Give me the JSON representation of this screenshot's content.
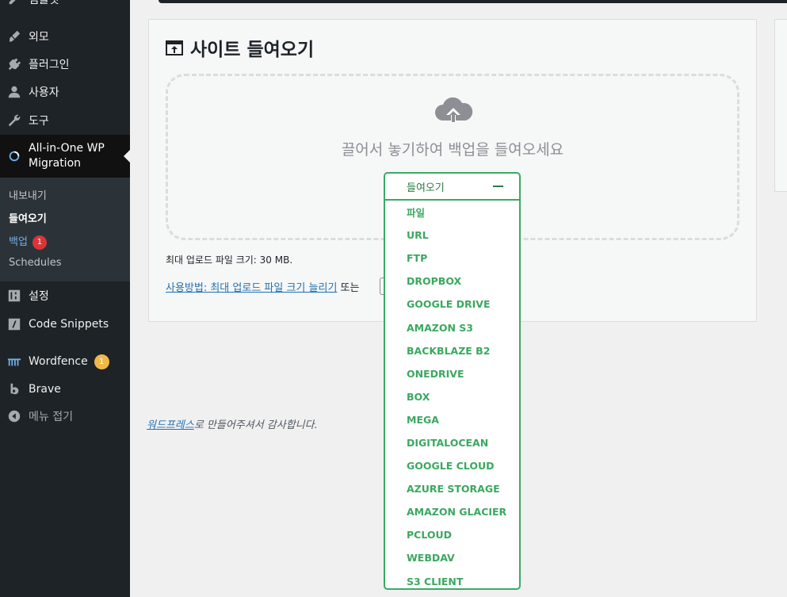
{
  "sidebar": {
    "items": [
      {
        "label": "템플릿",
        "icon": "pencil-icon"
      },
      {
        "label": "외모",
        "icon": "paintbrush-icon"
      },
      {
        "label": "플러그인",
        "icon": "plug-icon"
      },
      {
        "label": "사용자",
        "icon": "user-icon"
      },
      {
        "label": "도구",
        "icon": "wrench-icon"
      },
      {
        "label": "All-in-One WP Migration",
        "line1": "All-in-One WP",
        "line2": "Migration",
        "icon": "migration-icon"
      },
      {
        "label": "설정",
        "icon": "settings-icon"
      },
      {
        "label": "Code Snippets",
        "icon": "code-icon"
      },
      {
        "label": "Wordfence",
        "icon": "wordfence-icon",
        "badge": "1"
      },
      {
        "label": "Brave",
        "icon": "brave-icon"
      },
      {
        "label": "메뉴 접기",
        "icon": "collapse-icon"
      }
    ],
    "submenu": [
      {
        "label": "내보내기"
      },
      {
        "label": "들여오기"
      },
      {
        "label": "백업",
        "badge": "1"
      },
      {
        "label": "Schedules"
      }
    ]
  },
  "panel": {
    "title": "사이트 들여오기",
    "drop_text": "끌어서 놓기하여 백업을 들여오세요",
    "max_size": "최대 업로드 파일 크기: 30 MB.",
    "howto_link": "사용방법: 최대 업로드 파일 크기 늘리기",
    "howto_or": " 또는 "
  },
  "dropdown": {
    "label": "들여오기",
    "items": [
      "파일",
      "URL",
      "FTP",
      "DROPBOX",
      "GOOGLE DRIVE",
      "AMAZON S3",
      "BACKBLAZE B2",
      "ONEDRIVE",
      "BOX",
      "MEGA",
      "DIGITALOCEAN",
      "GOOGLE CLOUD",
      "AZURE STORAGE",
      "AMAZON GLACIER",
      "PCLOUD",
      "WEBDAV",
      "S3 CLIENT"
    ]
  },
  "footer": {
    "link": "워드프레스",
    "text": "로 만들어주셔서 감사합니다."
  },
  "colors": {
    "sidebar_bg": "#1d2327",
    "accent_green": "#3aaa66",
    "link_blue": "#2271b1",
    "badge_red": "#d63638",
    "badge_yellow": "#f0b849"
  }
}
